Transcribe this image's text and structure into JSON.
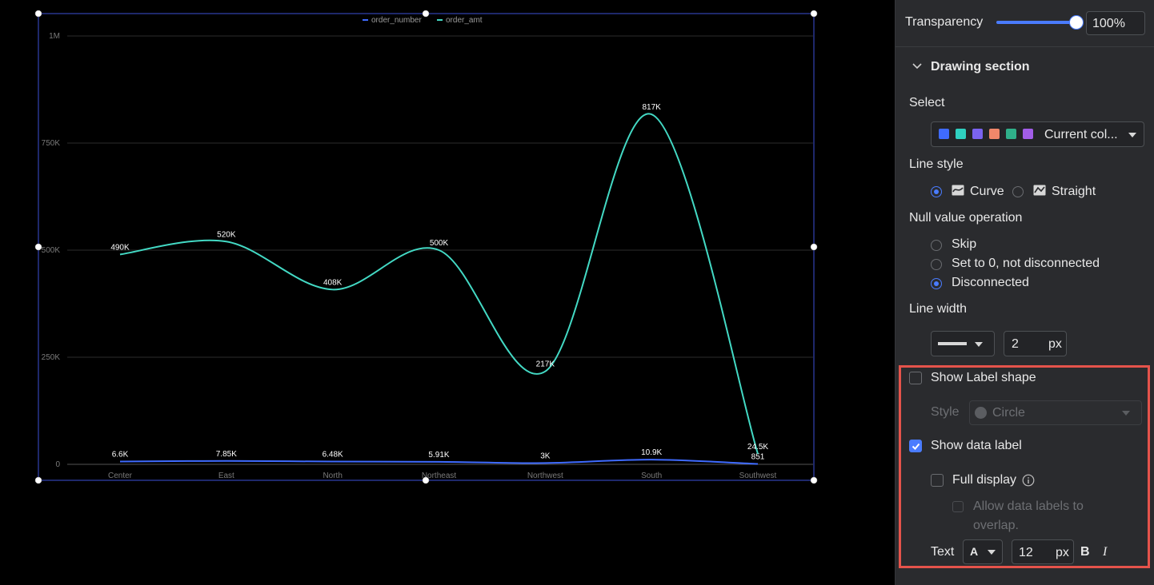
{
  "chart_data": {
    "type": "line",
    "categories": [
      "Center",
      "East",
      "North",
      "Northeast",
      "Northwest",
      "South",
      "Southwest"
    ],
    "series": [
      {
        "name": "order_number",
        "color": "#3f6bff",
        "values": [
          6600,
          7850,
          6480,
          5910,
          3000,
          10900,
          851
        ],
        "labels": [
          "6.6K",
          "7.85K",
          "6.48K",
          "5.91K",
          "3K",
          "10.9K",
          "851"
        ]
      },
      {
        "name": "order_amt",
        "color": "#43d9c4",
        "values": [
          490000,
          520000,
          408000,
          500000,
          217000,
          817000,
          24500
        ],
        "labels": [
          "490K",
          "520K",
          "408K",
          "500K",
          "217K",
          "817K",
          "24.5K"
        ]
      }
    ],
    "yticks": [
      "0",
      "250K",
      "500K",
      "750K",
      "1M"
    ],
    "ylim": [
      0,
      1000000
    ],
    "legend_position": "top-center",
    "grid": true,
    "curve": "smooth"
  },
  "panel": {
    "transparency": {
      "label": "Transparency",
      "value": "100%",
      "percent": 100
    },
    "drawing_section": {
      "title": "Drawing section"
    },
    "select": {
      "label": "Select",
      "value": "Current col...",
      "swatches": [
        "#3f6bff",
        "#2fd0c0",
        "#7a63f0",
        "#f0876a",
        "#2fb08a",
        "#a25de8"
      ]
    },
    "line_style": {
      "label": "Line style",
      "options": [
        "Curve",
        "Straight"
      ],
      "selected": "Curve"
    },
    "null_value": {
      "label": "Null value operation",
      "options": [
        "Skip",
        "Set to 0, not disconnected",
        "Disconnected"
      ],
      "selected": "Disconnected"
    },
    "line_width": {
      "label": "Line width",
      "value": "2",
      "unit": "px"
    },
    "label_shape": {
      "label": "Show Label shape",
      "checked": false,
      "style_label": "Style",
      "style_value": "Circle"
    },
    "data_label": {
      "label": "Show data label",
      "checked": true
    },
    "full_display": {
      "label": "Full display",
      "checked": false
    },
    "overlap": {
      "line1": "Allow data labels to",
      "line2": "overlap."
    },
    "text": {
      "label": "Text",
      "color_glyph": "A",
      "size": "12",
      "unit": "px",
      "bold": "B",
      "italic": "I"
    },
    "highlight_color": "#e5534b",
    "accent": "#4a7cff"
  }
}
